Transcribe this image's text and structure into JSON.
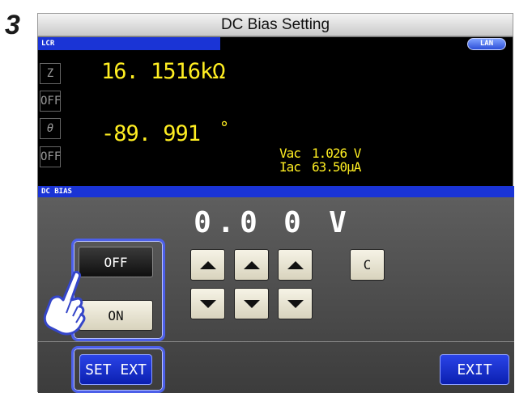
{
  "step_number": "3",
  "window_title": "DC Bias Setting",
  "status": {
    "mode_label": "LCR",
    "lan_label": "LAN"
  },
  "measure": {
    "z_label": "Z",
    "z_value": "16. 1516kΩ",
    "off_label_1": "OFF",
    "theta_label": "θ",
    "theta_value": "-89. 991",
    "theta_unit": "°",
    "off_label_2": "OFF",
    "vac_label": "Vac",
    "vac_value": "1.026 V",
    "iac_label": "Iac",
    "iac_value": "63.50μA"
  },
  "dcbias": {
    "section_label": "DC BIAS",
    "digits": [
      "0",
      ".",
      "0",
      "0"
    ],
    "unit": "V",
    "off_button": "OFF",
    "on_button": "ON",
    "clear_button": "C",
    "set_ext_button": "SET EXT",
    "exit_button": "EXIT",
    "selected": "OFF"
  },
  "colors": {
    "measure_value": "#ffee22",
    "header_bar": "#1a34d6",
    "highlight": "#4c5fe8"
  },
  "icons": [
    "hand-pointer-icon",
    "arrow-up-icon",
    "arrow-down-icon"
  ]
}
